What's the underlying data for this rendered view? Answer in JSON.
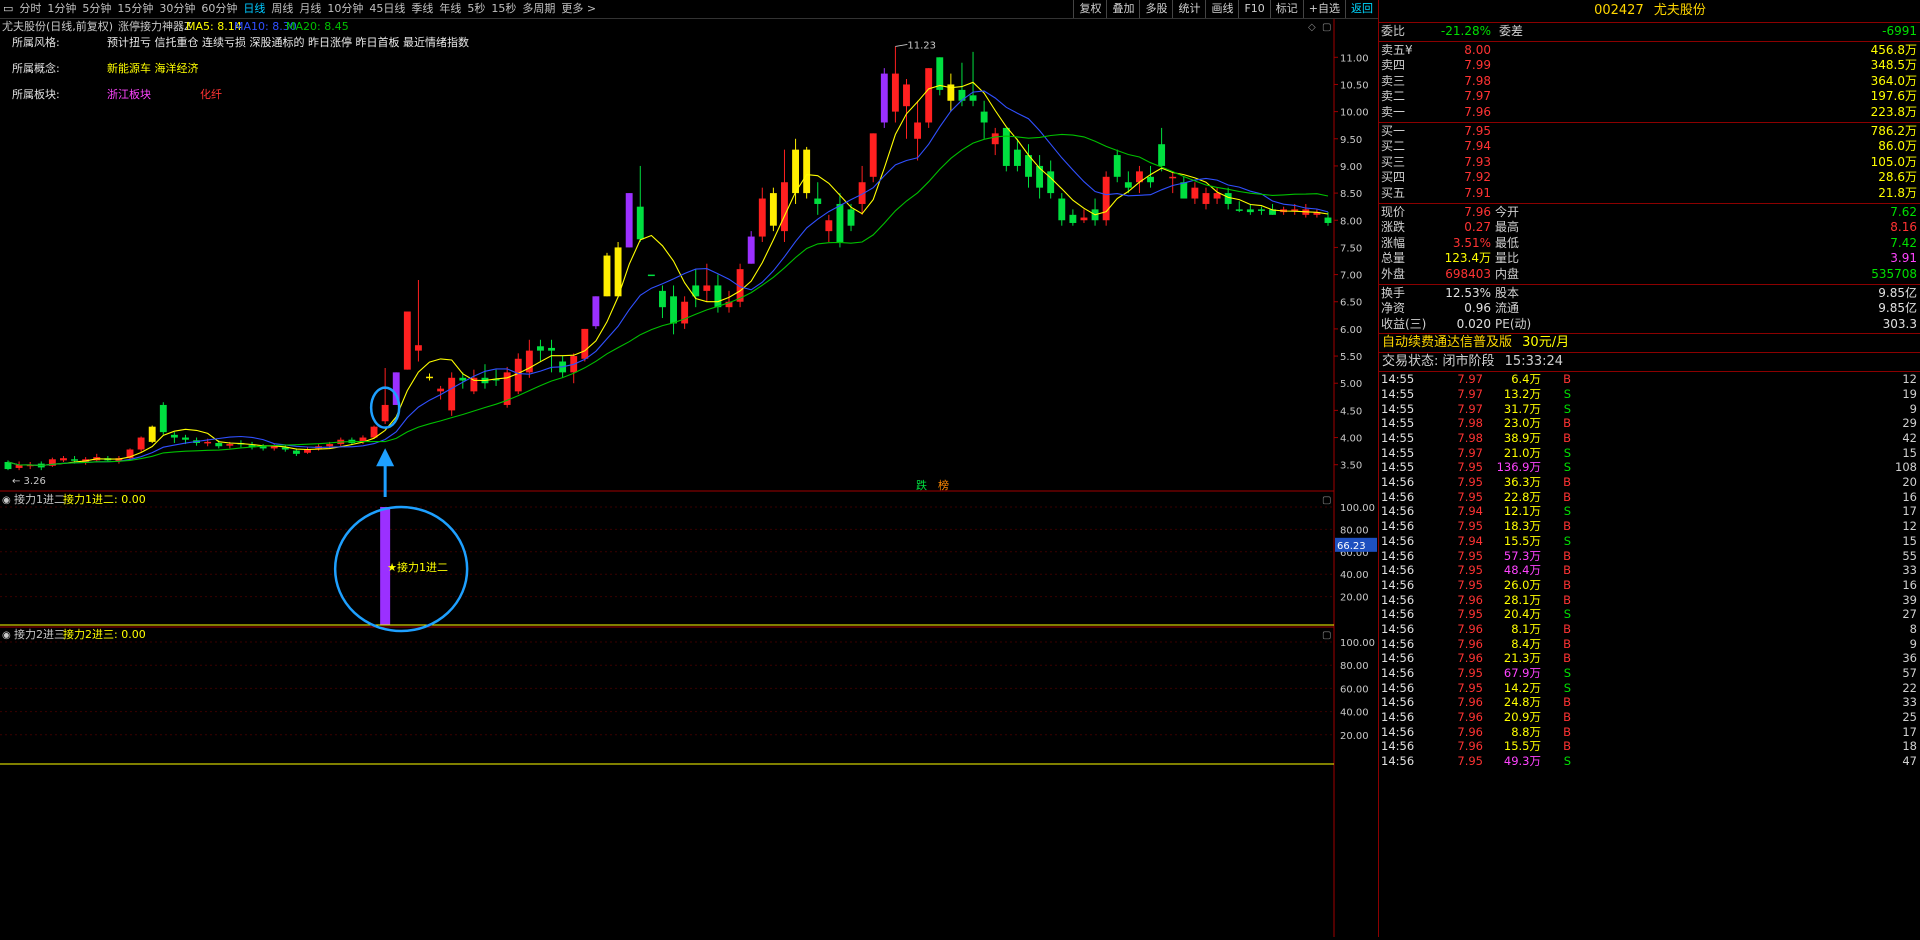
{
  "toolbar": {
    "tabs": [
      "分时",
      "1分钟",
      "5分钟",
      "15分钟",
      "30分钟",
      "60分钟",
      "日线",
      "周线",
      "月线",
      "10分钟",
      "45日线",
      "季线",
      "年线",
      "5秒",
      "15秒",
      "多周期",
      "更多 >"
    ],
    "active_tab": "日线",
    "right_buttons": [
      "复权",
      "叠加",
      "多股",
      "统计",
      "画线",
      "F10",
      "标记",
      "+自选",
      "返回"
    ]
  },
  "main_chart": {
    "header_stock": "尤夫股份(日线,前复权)",
    "indicator_name": "涨停接力神器Z",
    "ma5": "MA5: 8.14",
    "ma10": "MA10: 8.30",
    "ma20": "MA20: 8.45",
    "info_lines": [
      {
        "label": "所属风格:",
        "value": "预计扭亏 信托重仓 连续亏损 深股通标的 昨日涨停 昨日首板 最近情绪指数",
        "color": "#e8e8e8"
      },
      {
        "label": "所属概念:",
        "value": "新能源车 海洋经济",
        "color": "#ffff00"
      },
      {
        "label": "所属板块:",
        "value": "浙江板块",
        "value2": "化纤",
        "color": "#ff44ff",
        "color2": "#ff3333"
      }
    ],
    "y_labels": [
      "11.00",
      "10.50",
      "10.00",
      "9.50",
      "9.00",
      "8.50",
      "8.00",
      "7.50",
      "7.00",
      "6.50",
      "6.00",
      "5.50",
      "5.00",
      "4.50",
      "4.00",
      "3.50"
    ],
    "high_label": "11.23",
    "low_label": "3.26",
    "bottom_marks": [
      "跌",
      "榜"
    ]
  },
  "sub1": {
    "title": "接力1进二",
    "value": "接力1进二: 0.00",
    "annotation": "接力1进二",
    "y_labels": [
      "100.00",
      "80.00",
      "60.00",
      "40.00",
      "20.00"
    ],
    "cursor_value": "66.23"
  },
  "sub2": {
    "title": "接力2进三",
    "value": "接力2进三: 0.00",
    "y_labels": [
      "100.00",
      "80.00",
      "60.00",
      "40.00",
      "20.00"
    ]
  },
  "quote": {
    "code": "002427",
    "name": "尤夫股份",
    "weibi_label": "委比",
    "weibi": "-21.28%",
    "weicha_label": "委差",
    "weicha": "-6991",
    "asks": [
      {
        "label": "卖五",
        "sym": "¥",
        "price": "8.00",
        "vol": "456.8万"
      },
      {
        "label": "卖四",
        "sym": "",
        "price": "7.99",
        "vol": "348.5万"
      },
      {
        "label": "卖三",
        "sym": "",
        "price": "7.98",
        "vol": "364.0万"
      },
      {
        "label": "卖二",
        "sym": "",
        "price": "7.97",
        "vol": "197.6万"
      },
      {
        "label": "卖一",
        "sym": "",
        "price": "7.96",
        "vol": "223.8万"
      }
    ],
    "bids": [
      {
        "label": "买一",
        "price": "7.95",
        "vol": "786.2万"
      },
      {
        "label": "买二",
        "price": "7.94",
        "vol": "86.0万"
      },
      {
        "label": "买三",
        "price": "7.93",
        "vol": "105.0万"
      },
      {
        "label": "买四",
        "price": "7.92",
        "vol": "28.6万"
      },
      {
        "label": "买五",
        "price": "7.91",
        "vol": "21.8万"
      }
    ],
    "stats1": [
      {
        "l1": "现价",
        "v1": "7.96",
        "c1": "red",
        "l2": "今开",
        "v2": "7.62",
        "c2": "green"
      },
      {
        "l1": "涨跌",
        "v1": "0.27",
        "c1": "red",
        "l2": "最高",
        "v2": "8.16",
        "c2": "red"
      },
      {
        "l1": "涨幅",
        "v1": "3.51%",
        "c1": "red",
        "l2": "最低",
        "v2": "7.42",
        "c2": "green"
      },
      {
        "l1": "总量",
        "v1": "123.4万",
        "c1": "yellow",
        "l2": "量比",
        "v2": "3.91",
        "c2": "mag"
      },
      {
        "l1": "外盘",
        "v1": "698403",
        "c1": "red",
        "l2": "内盘",
        "v2": "535708",
        "c2": "green"
      }
    ],
    "stats2": [
      {
        "l1": "换手",
        "v1": "12.53%",
        "l2": "股本",
        "v2": "9.85亿"
      },
      {
        "l1": "净资",
        "v1": "0.96",
        "l2": "流通",
        "v2": "9.85亿"
      },
      {
        "l1": "收益(三)",
        "v1": "0.020",
        "l2": "PE(动)",
        "v2": "303.3"
      }
    ],
    "ad": "自动续费通达信普及版",
    "ad_price": "30元/月",
    "trade_state": "交易状态: 闭市阶段",
    "trade_time": "15:33:24"
  },
  "ticks": [
    {
      "t": "14:55",
      "p": "7.97",
      "v": "6.4万",
      "s": "B",
      "n": "12"
    },
    {
      "t": "14:55",
      "p": "7.97",
      "v": "13.2万",
      "s": "S",
      "n": "19"
    },
    {
      "t": "14:55",
      "p": "7.97",
      "v": "31.7万",
      "s": "S",
      "n": "9"
    },
    {
      "t": "14:55",
      "p": "7.98",
      "v": "23.0万",
      "s": "B",
      "n": "29"
    },
    {
      "t": "14:55",
      "p": "7.98",
      "v": "38.9万",
      "s": "B",
      "n": "42"
    },
    {
      "t": "14:55",
      "p": "7.97",
      "v": "21.0万",
      "s": "S",
      "n": "15"
    },
    {
      "t": "14:55",
      "p": "7.95",
      "v": "136.9万",
      "s": "S",
      "n": "108"
    },
    {
      "t": "14:56",
      "p": "7.95",
      "v": "36.3万",
      "s": "B",
      "n": "20"
    },
    {
      "t": "14:56",
      "p": "7.95",
      "v": "22.8万",
      "s": "B",
      "n": "16"
    },
    {
      "t": "14:56",
      "p": "7.94",
      "v": "12.1万",
      "s": "S",
      "n": "17"
    },
    {
      "t": "14:56",
      "p": "7.95",
      "v": "18.3万",
      "s": "B",
      "n": "12"
    },
    {
      "t": "14:56",
      "p": "7.94",
      "v": "15.5万",
      "s": "S",
      "n": "15"
    },
    {
      "t": "14:56",
      "p": "7.95",
      "v": "57.3万",
      "s": "B",
      "n": "55"
    },
    {
      "t": "14:56",
      "p": "7.95",
      "v": "48.4万",
      "s": "B",
      "n": "33"
    },
    {
      "t": "14:56",
      "p": "7.95",
      "v": "26.0万",
      "s": "B",
      "n": "16"
    },
    {
      "t": "14:56",
      "p": "7.96",
      "v": "28.1万",
      "s": "B",
      "n": "39"
    },
    {
      "t": "14:56",
      "p": "7.95",
      "v": "20.4万",
      "s": "S",
      "n": "27"
    },
    {
      "t": "14:56",
      "p": "7.96",
      "v": "8.1万",
      "s": "B",
      "n": "8"
    },
    {
      "t": "14:56",
      "p": "7.96",
      "v": "8.4万",
      "s": "B",
      "n": "9"
    },
    {
      "t": "14:56",
      "p": "7.96",
      "v": "21.3万",
      "s": "B",
      "n": "36"
    },
    {
      "t": "14:56",
      "p": "7.95",
      "v": "67.9万",
      "s": "S",
      "n": "57"
    },
    {
      "t": "14:56",
      "p": "7.95",
      "v": "14.2万",
      "s": "S",
      "n": "22"
    },
    {
      "t": "14:56",
      "p": "7.96",
      "v": "24.8万",
      "s": "B",
      "n": "33"
    },
    {
      "t": "14:56",
      "p": "7.96",
      "v": "20.9万",
      "s": "B",
      "n": "25"
    },
    {
      "t": "14:56",
      "p": "7.96",
      "v": "8.8万",
      "s": "B",
      "n": "17"
    },
    {
      "t": "14:56",
      "p": "7.96",
      "v": "15.5万",
      "s": "B",
      "n": "18"
    },
    {
      "t": "14:56",
      "p": "7.95",
      "v": "49.3万",
      "s": "S",
      "n": "47"
    }
  ],
  "candles": [
    [
      3.42,
      3.55,
      3.4,
      3.58,
      "g"
    ],
    [
      3.5,
      3.44,
      3.4,
      3.56,
      "r"
    ],
    [
      3.48,
      3.5,
      3.42,
      3.55,
      "r"
    ],
    [
      3.52,
      3.45,
      3.4,
      3.56,
      "g"
    ],
    [
      3.48,
      3.6,
      3.46,
      3.63,
      "r"
    ],
    [
      3.58,
      3.62,
      3.55,
      3.66,
      "r"
    ],
    [
      3.6,
      3.58,
      3.52,
      3.66,
      "g"
    ],
    [
      3.55,
      3.6,
      3.5,
      3.64,
      "r"
    ],
    [
      3.58,
      3.64,
      3.55,
      3.7,
      "r"
    ],
    [
      3.62,
      3.58,
      3.55,
      3.66,
      "g"
    ],
    [
      3.56,
      3.62,
      3.52,
      3.66,
      "r"
    ],
    [
      3.62,
      3.78,
      3.6,
      3.8,
      "r"
    ],
    [
      3.78,
      4.0,
      3.74,
      4.02,
      "r"
    ],
    [
      3.92,
      4.2,
      3.9,
      4.22,
      "y"
    ],
    [
      4.1,
      4.6,
      4.05,
      4.65,
      "g"
    ],
    [
      4.05,
      4.0,
      3.9,
      4.1,
      "g"
    ],
    [
      4.0,
      3.96,
      3.88,
      4.05,
      "g"
    ],
    [
      3.95,
      3.9,
      3.85,
      4.0,
      "g"
    ],
    [
      3.9,
      3.92,
      3.84,
      3.98,
      "r"
    ],
    [
      3.9,
      3.84,
      3.8,
      3.95,
      "g"
    ],
    [
      3.85,
      3.88,
      3.8,
      3.92,
      "r"
    ],
    [
      3.88,
      3.9,
      3.82,
      3.95,
      "g"
    ],
    [
      3.86,
      3.82,
      3.78,
      3.92,
      "g"
    ],
    [
      3.84,
      3.8,
      3.76,
      3.88,
      "g"
    ],
    [
      3.8,
      3.84,
      3.76,
      3.88,
      "r"
    ],
    [
      3.82,
      3.78,
      3.74,
      3.86,
      "g"
    ],
    [
      3.76,
      3.7,
      3.66,
      3.8,
      "g"
    ],
    [
      3.72,
      3.78,
      3.7,
      3.82,
      "r"
    ],
    [
      3.8,
      3.84,
      3.76,
      3.88,
      "r"
    ],
    [
      3.84,
      3.88,
      3.8,
      3.92,
      "r"
    ],
    [
      3.88,
      3.96,
      3.84,
      4.0,
      "r"
    ],
    [
      3.96,
      3.9,
      3.86,
      4.0,
      "g"
    ],
    [
      3.92,
      4.0,
      3.88,
      4.04,
      "r"
    ],
    [
      4.0,
      4.2,
      3.98,
      4.22,
      "r"
    ],
    [
      4.3,
      4.6,
      4.25,
      5.28,
      "r"
    ],
    [
      4.6,
      5.2,
      4.6,
      5.2,
      "p"
    ],
    [
      5.25,
      6.32,
      5.25,
      6.32,
      "r"
    ],
    [
      5.6,
      5.7,
      5.4,
      6.9,
      "r"
    ],
    [
      5.1,
      5.12,
      5.05,
      5.18,
      "y"
    ],
    [
      4.85,
      4.9,
      4.7,
      4.95,
      "r"
    ],
    [
      4.5,
      5.1,
      4.4,
      5.2,
      "r"
    ],
    [
      5.1,
      5.05,
      4.9,
      5.2,
      "g"
    ],
    [
      4.85,
      5.1,
      4.8,
      5.25,
      "r"
    ],
    [
      5.0,
      5.1,
      4.9,
      5.35,
      "g"
    ],
    [
      5.08,
      5.05,
      4.95,
      5.25,
      "g"
    ],
    [
      4.6,
      5.2,
      4.55,
      5.3,
      "r"
    ],
    [
      4.85,
      5.45,
      4.8,
      5.55,
      "r"
    ],
    [
      5.2,
      5.6,
      5.1,
      5.8,
      "r"
    ],
    [
      5.6,
      5.68,
      5.4,
      5.8,
      "g"
    ],
    [
      5.65,
      5.6,
      5.2,
      5.8,
      "g"
    ],
    [
      5.4,
      5.2,
      5.1,
      5.5,
      "g"
    ],
    [
      5.2,
      5.5,
      5.0,
      5.55,
      "r"
    ],
    [
      5.45,
      6.0,
      5.4,
      6.0,
      "r"
    ],
    [
      6.05,
      6.6,
      6.0,
      6.6,
      "p"
    ],
    [
      6.6,
      7.35,
      6.6,
      7.4,
      "y"
    ],
    [
      6.6,
      7.5,
      6.6,
      7.6,
      "y"
    ],
    [
      7.5,
      8.5,
      7.5,
      8.5,
      "p"
    ],
    [
      7.65,
      8.25,
      7.6,
      9.0,
      "g"
    ],
    [
      7.0,
      7.0,
      7.0,
      7.0,
      "g"
    ],
    [
      6.7,
      6.4,
      6.2,
      6.8,
      "g"
    ],
    [
      6.6,
      6.1,
      5.9,
      6.8,
      "g"
    ],
    [
      6.1,
      6.5,
      6.0,
      6.6,
      "r"
    ],
    [
      6.6,
      6.8,
      6.4,
      7.1,
      "g"
    ],
    [
      6.8,
      6.7,
      6.5,
      7.2,
      "r"
    ],
    [
      6.8,
      6.4,
      6.3,
      7.0,
      "g"
    ],
    [
      6.4,
      6.5,
      6.3,
      6.7,
      "r"
    ],
    [
      6.5,
      7.1,
      6.4,
      7.2,
      "r"
    ],
    [
      7.2,
      7.7,
      7.2,
      7.8,
      "p"
    ],
    [
      7.7,
      8.4,
      7.6,
      8.6,
      "r"
    ],
    [
      7.9,
      8.5,
      7.8,
      8.6,
      "y"
    ],
    [
      7.8,
      8.7,
      7.6,
      9.3,
      "r"
    ],
    [
      8.5,
      9.3,
      8.3,
      9.5,
      "y"
    ],
    [
      8.5,
      9.3,
      8.4,
      9.35,
      "y"
    ],
    [
      8.4,
      8.3,
      8.1,
      8.7,
      "g"
    ],
    [
      8.0,
      7.8,
      7.6,
      8.1,
      "r"
    ],
    [
      8.3,
      7.6,
      7.5,
      8.5,
      "g"
    ],
    [
      7.9,
      8.2,
      7.8,
      8.3,
      "g"
    ],
    [
      8.3,
      8.7,
      8.1,
      9.0,
      "r"
    ],
    [
      8.8,
      9.6,
      8.7,
      9.6,
      "r"
    ],
    [
      9.8,
      10.7,
      9.7,
      10.8,
      "p"
    ],
    [
      10.0,
      10.7,
      9.8,
      11.2,
      "r"
    ],
    [
      10.5,
      10.1,
      9.5,
      10.6,
      "r"
    ],
    [
      9.5,
      9.8,
      9.1,
      10.2,
      "r"
    ],
    [
      9.8,
      10.8,
      9.7,
      10.8,
      "r"
    ],
    [
      10.4,
      11.0,
      10.3,
      11.0,
      "g"
    ],
    [
      10.2,
      10.5,
      10.0,
      10.7,
      "y"
    ],
    [
      10.4,
      10.2,
      10.1,
      10.9,
      "g"
    ],
    [
      10.3,
      10.2,
      10.1,
      11.1,
      "g"
    ],
    [
      10.0,
      9.8,
      9.5,
      10.2,
      "g"
    ],
    [
      9.6,
      9.4,
      9.2,
      9.7,
      "r"
    ],
    [
      9.7,
      9.0,
      8.9,
      9.7,
      "g"
    ],
    [
      9.3,
      9.0,
      8.9,
      9.5,
      "g"
    ],
    [
      9.2,
      8.8,
      8.6,
      9.4,
      "g"
    ],
    [
      9.0,
      8.6,
      8.4,
      9.2,
      "g"
    ],
    [
      8.9,
      8.5,
      8.4,
      9.1,
      "g"
    ],
    [
      8.4,
      8.0,
      7.9,
      8.5,
      "g"
    ],
    [
      8.1,
      7.95,
      7.9,
      8.2,
      "g"
    ],
    [
      8.0,
      8.05,
      7.95,
      8.2,
      "r"
    ],
    [
      8.2,
      8.0,
      7.9,
      8.4,
      "g"
    ],
    [
      8.0,
      8.8,
      7.9,
      8.9,
      "r"
    ],
    [
      8.8,
      9.2,
      8.7,
      9.3,
      "g"
    ],
    [
      8.7,
      8.6,
      8.5,
      8.9,
      "g"
    ],
    [
      8.7,
      8.9,
      8.5,
      9.0,
      "r"
    ],
    [
      8.8,
      8.7,
      8.6,
      9.0,
      "g"
    ],
    [
      9.0,
      9.4,
      8.9,
      9.7,
      "g"
    ],
    [
      8.8,
      8.8,
      8.5,
      8.9,
      "r"
    ],
    [
      8.7,
      8.4,
      8.4,
      8.8,
      "g"
    ],
    [
      8.4,
      8.6,
      8.3,
      8.7,
      "r"
    ],
    [
      8.5,
      8.3,
      8.2,
      8.6,
      "r"
    ],
    [
      8.4,
      8.5,
      8.3,
      8.6,
      "r"
    ],
    [
      8.5,
      8.3,
      8.2,
      8.6,
      "g"
    ],
    [
      8.2,
      8.2,
      8.15,
      8.35,
      "g"
    ],
    [
      8.2,
      8.15,
      8.1,
      8.3,
      "g"
    ],
    [
      8.2,
      8.2,
      8.1,
      8.25,
      "g"
    ],
    [
      8.2,
      8.1,
      8.1,
      8.3,
      "g"
    ],
    [
      8.15,
      8.2,
      8.1,
      8.25,
      "r"
    ],
    [
      8.2,
      8.18,
      8.1,
      8.3,
      "r"
    ],
    [
      8.2,
      8.1,
      8.05,
      8.3,
      "r"
    ],
    [
      8.1,
      8.15,
      8.05,
      8.2,
      "r"
    ],
    [
      8.05,
      7.95,
      7.9,
      8.15,
      "g"
    ]
  ],
  "relay_bar": {
    "index": 34,
    "value": 100
  }
}
